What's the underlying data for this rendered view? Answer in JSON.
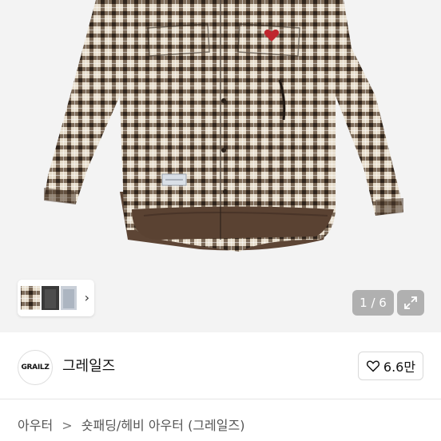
{
  "gallery": {
    "counter": "1 / 6",
    "expand_icon": "expand-icon",
    "thumb_chevron": "›"
  },
  "brand": {
    "logo_text": "GRAILZ",
    "name": "그레일즈",
    "like_count": "6.6만",
    "like_icon": "heart-icon"
  },
  "breadcrumb": {
    "root": "아우터",
    "separator": ">",
    "leaf": "숏패딩/헤비 아우터 (그레일즈)"
  },
  "colors": {
    "plaid_dark": "#4a3a2a",
    "plaid_light": "#e8e0cf",
    "lining": "#5b4434",
    "background": "#f3f3f3"
  }
}
